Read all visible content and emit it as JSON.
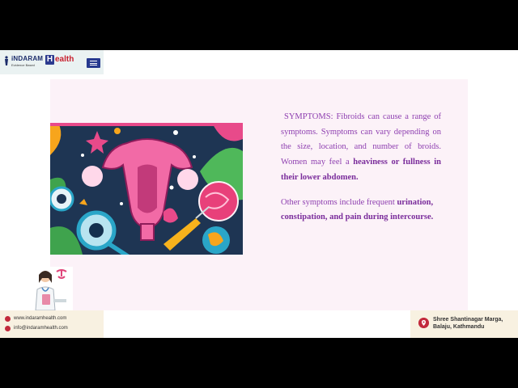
{
  "header": {
    "brand_name": "iNDARAM",
    "brand_sub": "Evidence Based",
    "brand_h": "H",
    "brand_health": "ealth",
    "menu_icon": "hamburger-menu-icon"
  },
  "content": {
    "p1_a": "SYMPTOMS: Fibroids can cause a range of symptoms. Symptoms can vary depending on the size, location, and number of broids. Women may feel a ",
    "p1_b": "heaviness or fullness in their lower abdomen.",
    "p2_a": "Other symptoms include frequent ",
    "p2_b": "urination, constipation, and pain during intercourse."
  },
  "footer": {
    "website": "www.indaramhealth.com",
    "email": "info@indaramhealth.com",
    "address_line1": "Shree Shantinagar Marga,",
    "address_line2": "Balaju, Kathmandu"
  },
  "colors": {
    "slide_bg": "#fcf2f8",
    "text_purple": "#8e3fb0",
    "brand_blue": "#26398f",
    "brand_red": "#c8202f"
  }
}
